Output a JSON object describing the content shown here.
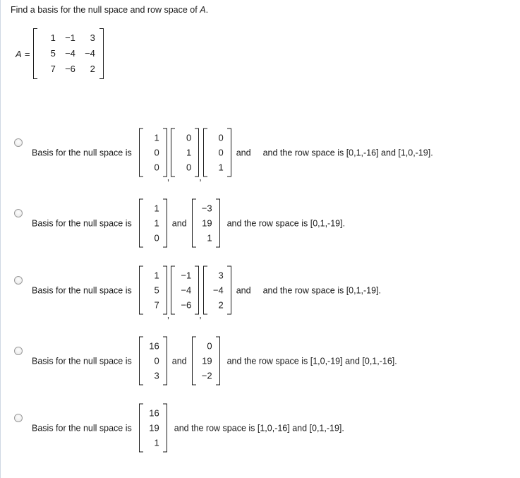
{
  "prompt": {
    "text_before": "Find a basis for the null space and row space of ",
    "variable": "A",
    "text_after": "."
  },
  "matrix": {
    "label": "A =",
    "rows": [
      [
        "1",
        "−1",
        "3"
      ],
      [
        "5",
        "−4",
        "−4"
      ],
      [
        "7",
        "−6",
        "2"
      ]
    ]
  },
  "labels": {
    "basis_prefix": "Basis for the null space is",
    "and": "and",
    "comma": ","
  },
  "options": [
    {
      "vectors": [
        [
          "1",
          "0",
          "0"
        ],
        [
          "0",
          "1",
          "0"
        ],
        [
          "0",
          "0",
          "1"
        ]
      ],
      "separators": [
        ",",
        ",",
        "and"
      ],
      "tail": "and the row space is [0,1,-16] and [1,0,-19]."
    },
    {
      "vectors": [
        [
          "1",
          "1",
          "0"
        ],
        [
          "−3",
          "19",
          "1"
        ]
      ],
      "separators": [
        "and"
      ],
      "tail": "and the row space is [0,1,-19]."
    },
    {
      "vectors": [
        [
          "1",
          "5",
          "7"
        ],
        [
          "−1",
          "−4",
          "−6"
        ],
        [
          "3",
          "−4",
          "2"
        ]
      ],
      "separators": [
        ",",
        ",",
        "and"
      ],
      "tail": "and the row space is [0,1,-19]."
    },
    {
      "vectors": [
        [
          "16",
          "0",
          "3"
        ],
        [
          "0",
          "19",
          "−2"
        ]
      ],
      "separators": [
        "and"
      ],
      "tail": "and the row space is [1,0,-19] and [0,1,-16]."
    },
    {
      "vectors": [
        [
          "16",
          "19",
          "1"
        ]
      ],
      "separators": [],
      "tail": "and the row space is [1,0,-16] and [0,1,-19]."
    }
  ],
  "layout": {
    "option_tops": [
      196,
      296,
      391,
      491,
      586
    ],
    "option_row_tops": [
      216,
      316,
      411,
      511,
      606
    ]
  },
  "colors": {
    "text": "#1a1a1a",
    "rule": "#cfd8e3",
    "radio_border": "#9a9a9a"
  }
}
